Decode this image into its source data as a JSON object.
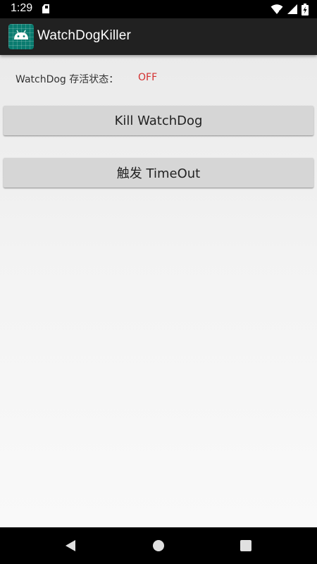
{
  "status_bar": {
    "time": "1:29",
    "icons": [
      "sd-card-icon",
      "wifi-icon",
      "cell-signal-icon",
      "battery-charging-icon"
    ]
  },
  "app_bar": {
    "title": "WatchDogKiller",
    "icon": "android-icon",
    "icon_color": "#0a7b6f"
  },
  "main": {
    "status_label": "WatchDog 存活状态：",
    "status_value": "OFF",
    "status_value_color": "#d32f2f",
    "kill_button_label": "Kill WatchDog",
    "timeout_button_label": "触发 TimeOut"
  },
  "nav_bar": {
    "icons": [
      "back-icon",
      "home-icon",
      "recents-icon"
    ]
  }
}
